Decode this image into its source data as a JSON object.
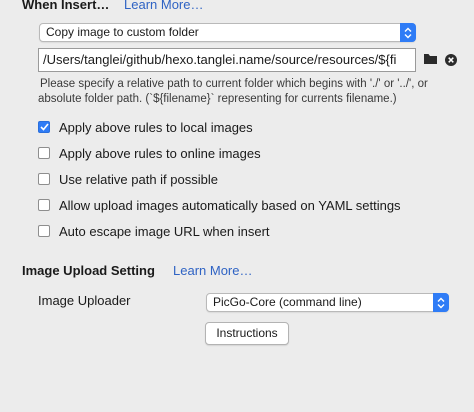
{
  "insert_section": {
    "heading": "When Insert…",
    "learn_more": "Learn More…",
    "action_select": "Copy image to custom folder",
    "path_value": "/Users/tanglei/github/hexo.tanglei.name/source/resources/${fi",
    "hint_line1": "Please specify a relative path to current folder which begins with './' or '../', or",
    "hint_line2": "absolute folder path. (`${filename}` representing for currents filename.)"
  },
  "options": [
    {
      "label": "Apply above rules to local images",
      "checked": true
    },
    {
      "label": "Apply above rules to online images",
      "checked": false
    },
    {
      "label": "Use relative path if possible",
      "checked": false
    },
    {
      "label": "Allow upload images automatically based on YAML settings",
      "checked": false
    },
    {
      "label": "Auto escape image URL when insert",
      "checked": false
    }
  ],
  "upload_section": {
    "heading": "Image Upload Setting",
    "learn_more": "Learn More…",
    "uploader_label": "Image Uploader",
    "uploader_select": "PicGo-Core (command line)",
    "instructions_button": "Instructions"
  },
  "icons": {
    "folder": "folder-icon",
    "clear": "clear-circle-icon",
    "checkmark": "checkmark-icon",
    "select_arrows": "up-down-chevron-icon"
  },
  "colors": {
    "accent": "#2f7cf6",
    "link": "#2f63c4",
    "background": "#ececec"
  }
}
